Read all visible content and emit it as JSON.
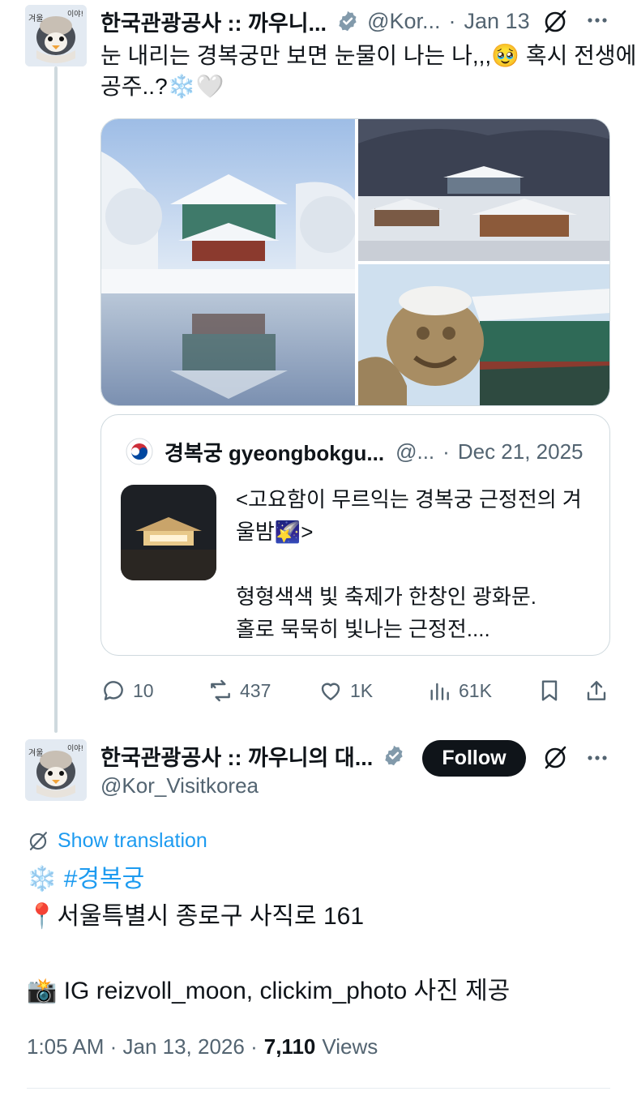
{
  "post": {
    "author_name": "한국관광공사 :: 까우니...",
    "handle": "@Kor...",
    "separator": "·",
    "date": "Jan 13",
    "text_line1": "눈 내리는 경복궁만 보면 눈물이 나는 나,,,",
    "text_line1_end": "혹시 전생에",
    "text_line2": "공주..?",
    "emoji_teary": "🥹",
    "emoji_snow": "❄️",
    "emoji_heart": "🤍",
    "avatar_text": "겨울 이야!",
    "images": [
      "hyangwonjeong-pavilion-snow-photo",
      "gyeongbokgung-aerial-snow-photo",
      "haechi-statue-snow-photo"
    ]
  },
  "quote": {
    "author_name": "경복궁 gyeongbokgu...",
    "handle": "@...",
    "separator": "·",
    "date": "Dec 21, 2025",
    "line1": "<고요함이 무르익는 경복궁 근정전의 겨",
    "line2a": "울밤",
    "line2b": ">",
    "line3": "형형색색 빛 축제가 한창인 광화문.",
    "line4": "홀로 묵묵히 빛나는 근정전....",
    "emoji_star": "🌠"
  },
  "actions": {
    "replies": "10",
    "reposts": "437",
    "likes": "1K",
    "views": "61K"
  },
  "main": {
    "author_name": "한국관광공사 :: 까우니의 대...",
    "handle": "@Kor_Visitkorea",
    "follow_label": "Follow",
    "show_translation": "Show translation",
    "hashtag": "#경복궁",
    "address": "서울특별시 종로구 사직로 161",
    "credit": "IG reizvoll_moon, clickim_photo 사진 제공",
    "emoji_snow": "❄️",
    "emoji_pin": "📍",
    "emoji_camera": "📸",
    "timestamp": "1:05 AM · Jan 13, 2026 ·",
    "views_count": "7,110",
    "views_label": "Views"
  },
  "colors": {
    "text": "#0f1419",
    "muted": "#536471",
    "link": "#1d9bf0",
    "border": "#cfd9de",
    "verified_badge": "#829aab"
  }
}
